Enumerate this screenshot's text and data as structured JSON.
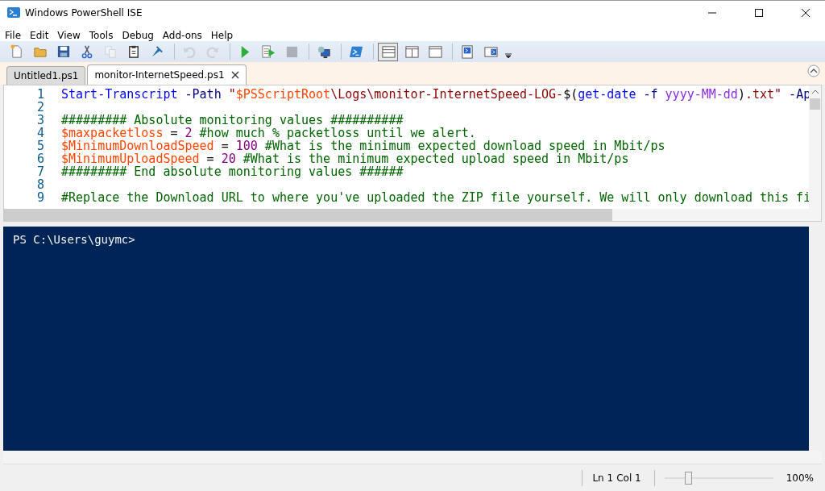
{
  "window": {
    "title": "Windows PowerShell ISE"
  },
  "menu": [
    "File",
    "Edit",
    "View",
    "Tools",
    "Debug",
    "Add-ons",
    "Help"
  ],
  "toolbar": [
    {
      "kind": "new",
      "disabled": false,
      "selected": false
    },
    {
      "kind": "open",
      "disabled": false,
      "selected": false
    },
    {
      "kind": "save",
      "disabled": false,
      "selected": false
    },
    {
      "kind": "cut",
      "disabled": false,
      "selected": false
    },
    {
      "kind": "copy",
      "disabled": true,
      "selected": false
    },
    {
      "kind": "paste",
      "disabled": false,
      "selected": false
    },
    {
      "kind": "clear",
      "disabled": false,
      "selected": false
    },
    {
      "kind": "sep"
    },
    {
      "kind": "undo",
      "disabled": true,
      "selected": false
    },
    {
      "kind": "redo",
      "disabled": true,
      "selected": false
    },
    {
      "kind": "sep"
    },
    {
      "kind": "run",
      "disabled": false,
      "selected": false
    },
    {
      "kind": "runsel",
      "disabled": false,
      "selected": false
    },
    {
      "kind": "stop",
      "disabled": true,
      "selected": false
    },
    {
      "kind": "sep"
    },
    {
      "kind": "remote",
      "disabled": false,
      "selected": false
    },
    {
      "kind": "sep"
    },
    {
      "kind": "console",
      "disabled": false,
      "selected": false
    },
    {
      "kind": "sep"
    },
    {
      "kind": "paneTop",
      "disabled": false,
      "selected": true
    },
    {
      "kind": "paneRight",
      "disabled": false,
      "selected": false
    },
    {
      "kind": "paneMax",
      "disabled": false,
      "selected": false
    },
    {
      "kind": "sep"
    },
    {
      "kind": "cmdpane",
      "disabled": false,
      "selected": false
    },
    {
      "kind": "addon",
      "disabled": false,
      "selected": false
    }
  ],
  "tabs": [
    {
      "label": "Untitled1.ps1",
      "selected": false
    },
    {
      "label": "monitor-InternetSpeed.ps1",
      "selected": true
    }
  ],
  "editor": {
    "lines": [
      {
        "number": "1",
        "tokens": [
          {
            "kind": "cmd",
            "text": "Start-Transcript"
          },
          {
            "kind": "param",
            "text": " -Path"
          },
          {
            "kind": "str",
            "text": " \""
          },
          {
            "kind": "var",
            "text": "$PSScriptRoot"
          },
          {
            "kind": "str",
            "text": "\\Logs\\monitor-InternetSpeed-LOG-"
          },
          {
            "kind": "op",
            "text": "$("
          },
          {
            "kind": "cmd",
            "text": "get-date"
          },
          {
            "kind": "param",
            "text": " -f"
          },
          {
            "kind": "arg",
            "text": " yyyy-MM-dd"
          },
          {
            "kind": "op",
            "text": ")"
          },
          {
            "kind": "str",
            "text": ".txt\""
          },
          {
            "kind": "param",
            "text": " -Ap"
          }
        ]
      },
      {
        "number": "2"
      },
      {
        "number": "3",
        "tokens": [
          {
            "kind": "comment",
            "text": "######### Absolute monitoring values ##########"
          }
        ]
      },
      {
        "number": "4",
        "tokens": [
          {
            "kind": "var",
            "text": "$maxpacketloss"
          },
          {
            "kind": "op",
            "text": " = "
          },
          {
            "kind": "num",
            "text": "2"
          },
          {
            "kind": "comment",
            "text": " #how much % packetloss until we alert."
          }
        ]
      },
      {
        "number": "5",
        "tokens": [
          {
            "kind": "var",
            "text": "$MinimumDownloadSpeed"
          },
          {
            "kind": "op",
            "text": " = "
          },
          {
            "kind": "num",
            "text": "100"
          },
          {
            "kind": "comment",
            "text": " #What is the minimum expected download speed in Mbit/ps"
          }
        ]
      },
      {
        "number": "6",
        "tokens": [
          {
            "kind": "var",
            "text": "$MinimumUploadSpeed"
          },
          {
            "kind": "op",
            "text": " = "
          },
          {
            "kind": "num",
            "text": "20"
          },
          {
            "kind": "comment",
            "text": " #What is the minimum expected upload speed in Mbit/ps"
          }
        ]
      },
      {
        "number": "7",
        "tokens": [
          {
            "kind": "comment",
            "text": "######### End absolute monitoring values ######"
          }
        ]
      },
      {
        "number": "8"
      },
      {
        "number": "9",
        "tokens": [
          {
            "kind": "comment",
            "text": "#Replace the Download URL to where you've uploaded the ZIP file yourself. We will only download this fi"
          }
        ]
      }
    ]
  },
  "console": {
    "prompt": "PS C:\\Users\\guymc>"
  },
  "status_bar": {
    "line": "Ln 1",
    "column": "Col 1",
    "zoom": {
      "level": 0.21,
      "reading": "100%"
    }
  }
}
